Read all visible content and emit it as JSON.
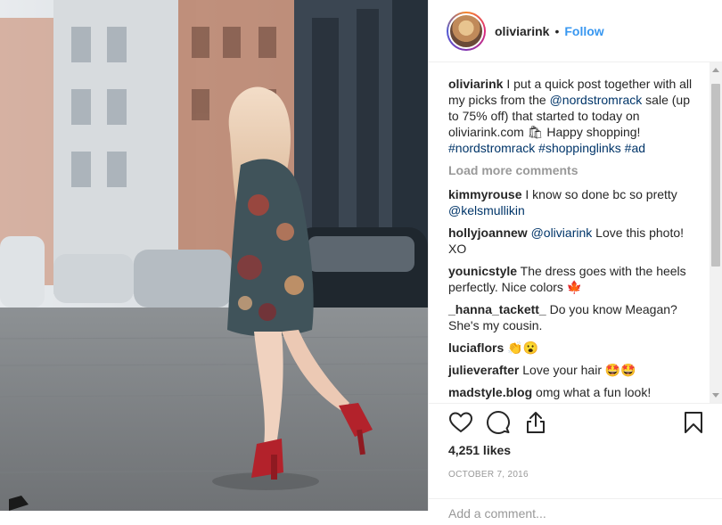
{
  "header": {
    "username": "oliviarink",
    "dot": "•",
    "follow_label": "Follow"
  },
  "caption": {
    "username": "oliviarink",
    "text_1": "I put a quick post together with all my picks from the",
    "mention": "@nordstromrack",
    "text_2": "sale (up to 75% off) that started to today on oliviarink.com 🛍 Happy shopping!",
    "tag_1": "#nordstromrack",
    "tag_2": "#shoppinglinks",
    "tag_3": "#ad"
  },
  "load_more_label": "Load more comments",
  "comments": [
    {
      "user": "kimmyrouse",
      "text": "I know so done bc so pretty",
      "mention": "@kelsmullikin"
    },
    {
      "user": "hollyjoannew",
      "mention": "@oliviarink",
      "text": "Love this photo! XO"
    },
    {
      "user": "younicstyle",
      "text": "The dress goes with the heels perfectly. Nice colors 🍁"
    },
    {
      "user": "_hanna_tackett_",
      "text": "Do you know Meagan? She's my cousin."
    },
    {
      "user": "luciaflors",
      "text": "👏😮"
    },
    {
      "user": "julieverafter",
      "text": "Love your hair 🤩🤩"
    },
    {
      "user": "madstyle.blog",
      "text": "omg what a fun look!"
    }
  ],
  "actions": {
    "icons": [
      "heart-icon",
      "comment-icon",
      "share-icon",
      "bookmark-icon"
    ],
    "likes": "4,251 likes",
    "date": "OCTOBER 7, 2016"
  },
  "add_comment": {
    "placeholder": "Add a comment..."
  },
  "colors": {
    "link": "#003569",
    "follow": "#3897f0",
    "muted": "#999999"
  }
}
